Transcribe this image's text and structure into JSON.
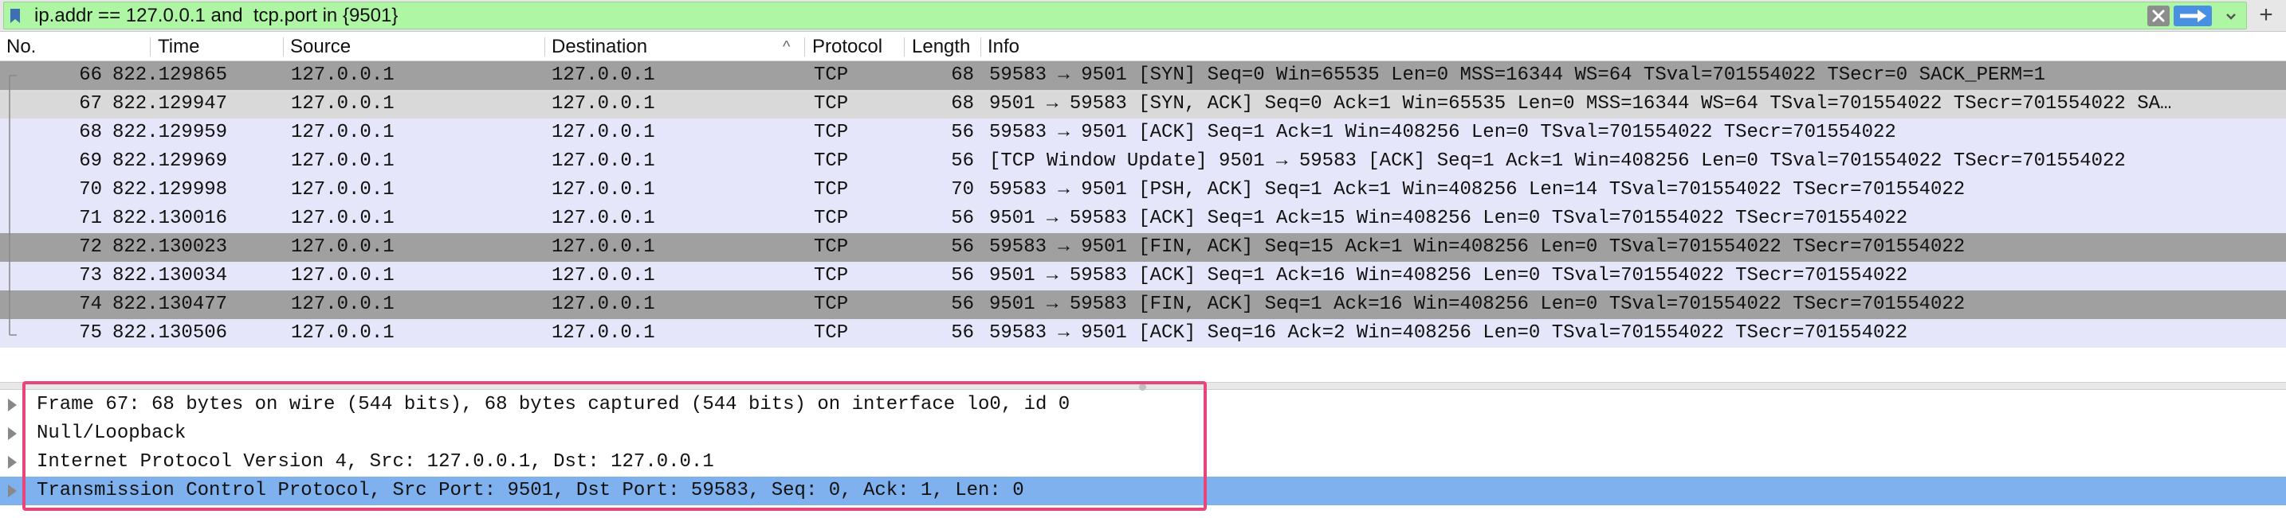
{
  "filter": {
    "text": "ip.addr == 127.0.0.1 and  tcp.port in {9501}"
  },
  "columns": [
    {
      "key": "no",
      "label": "No."
    },
    {
      "key": "time",
      "label": "Time"
    },
    {
      "key": "source",
      "label": "Source"
    },
    {
      "key": "destination",
      "label": "Destination"
    },
    {
      "key": "protocol",
      "label": "Protocol"
    },
    {
      "key": "length",
      "label": "Length"
    },
    {
      "key": "info",
      "label": "Info"
    }
  ],
  "sort_indicator": "^",
  "packets": [
    {
      "no": "66",
      "time": "822.129865",
      "source": "127.0.0.1",
      "destination": "127.0.0.1",
      "protocol": "TCP",
      "length": "68",
      "info": "59583 → 9501 [SYN] Seq=0 Win=65535 Len=0 MSS=16344 WS=64 TSval=701554022 TSecr=0 SACK_PERM=1",
      "style": "dark"
    },
    {
      "no": "67",
      "time": "822.129947",
      "source": "127.0.0.1",
      "destination": "127.0.0.1",
      "protocol": "TCP",
      "length": "68",
      "info": "9501 → 59583 [SYN, ACK] Seq=0 Ack=1 Win=65535 Len=0 MSS=16344 WS=64 TSval=701554022 TSecr=701554022 SA…",
      "style": "selected"
    },
    {
      "no": "68",
      "time": "822.129959",
      "source": "127.0.0.1",
      "destination": "127.0.0.1",
      "protocol": "TCP",
      "length": "56",
      "info": "59583 → 9501 [ACK] Seq=1 Ack=1 Win=408256 Len=0 TSval=701554022 TSecr=701554022",
      "style": "light"
    },
    {
      "no": "69",
      "time": "822.129969",
      "source": "127.0.0.1",
      "destination": "127.0.0.1",
      "protocol": "TCP",
      "length": "56",
      "info": "[TCP Window Update] 9501 → 59583 [ACK] Seq=1 Ack=1 Win=408256 Len=0 TSval=701554022 TSecr=701554022",
      "style": "light"
    },
    {
      "no": "70",
      "time": "822.129998",
      "source": "127.0.0.1",
      "destination": "127.0.0.1",
      "protocol": "TCP",
      "length": "70",
      "info": "59583 → 9501 [PSH, ACK] Seq=1 Ack=1 Win=408256 Len=14 TSval=701554022 TSecr=701554022",
      "style": "light"
    },
    {
      "no": "71",
      "time": "822.130016",
      "source": "127.0.0.1",
      "destination": "127.0.0.1",
      "protocol": "TCP",
      "length": "56",
      "info": "9501 → 59583 [ACK] Seq=1 Ack=15 Win=408256 Len=0 TSval=701554022 TSecr=701554022",
      "style": "light"
    },
    {
      "no": "72",
      "time": "822.130023",
      "source": "127.0.0.1",
      "destination": "127.0.0.1",
      "protocol": "TCP",
      "length": "56",
      "info": "59583 → 9501 [FIN, ACK] Seq=15 Ack=1 Win=408256 Len=0 TSval=701554022 TSecr=701554022",
      "style": "dark"
    },
    {
      "no": "73",
      "time": "822.130034",
      "source": "127.0.0.1",
      "destination": "127.0.0.1",
      "protocol": "TCP",
      "length": "56",
      "info": "9501 → 59583 [ACK] Seq=1 Ack=16 Win=408256 Len=0 TSval=701554022 TSecr=701554022",
      "style": "light"
    },
    {
      "no": "74",
      "time": "822.130477",
      "source": "127.0.0.1",
      "destination": "127.0.0.1",
      "protocol": "TCP",
      "length": "56",
      "info": "9501 → 59583 [FIN, ACK] Seq=1 Ack=16 Win=408256 Len=0 TSval=701554022 TSecr=701554022",
      "style": "dark"
    },
    {
      "no": "75",
      "time": "822.130506",
      "source": "127.0.0.1",
      "destination": "127.0.0.1",
      "protocol": "TCP",
      "length": "56",
      "info": "59583 → 9501 [ACK] Seq=16 Ack=2 Win=408256 Len=0 TSval=701554022 TSecr=701554022",
      "style": "light"
    }
  ],
  "details": [
    {
      "text": "Frame 67: 68 bytes on wire (544 bits), 68 bytes captured (544 bits) on interface lo0, id 0",
      "selected": false
    },
    {
      "text": "Null/Loopback",
      "selected": false
    },
    {
      "text": "Internet Protocol Version 4, Src: 127.0.0.1, Dst: 127.0.0.1",
      "selected": false
    },
    {
      "text": "Transmission Control Protocol, Src Port: 9501, Dst Port: 59583, Seq: 0, Ack: 1, Len: 0",
      "selected": true
    }
  ],
  "colors": {
    "filter_bg": "#aff6a4",
    "row_dark": "#a0a0a0",
    "row_selected": "#d9d9d9",
    "row_light": "#e6e6fa",
    "detail_selected": "#7eb1ee",
    "annotation": "#e8457a"
  },
  "icons": {
    "bookmark": "bookmark-icon",
    "clear": "clear-filter-icon",
    "apply": "apply-arrow-icon",
    "dropdown": "chevron-down-icon",
    "add": "plus-icon"
  }
}
